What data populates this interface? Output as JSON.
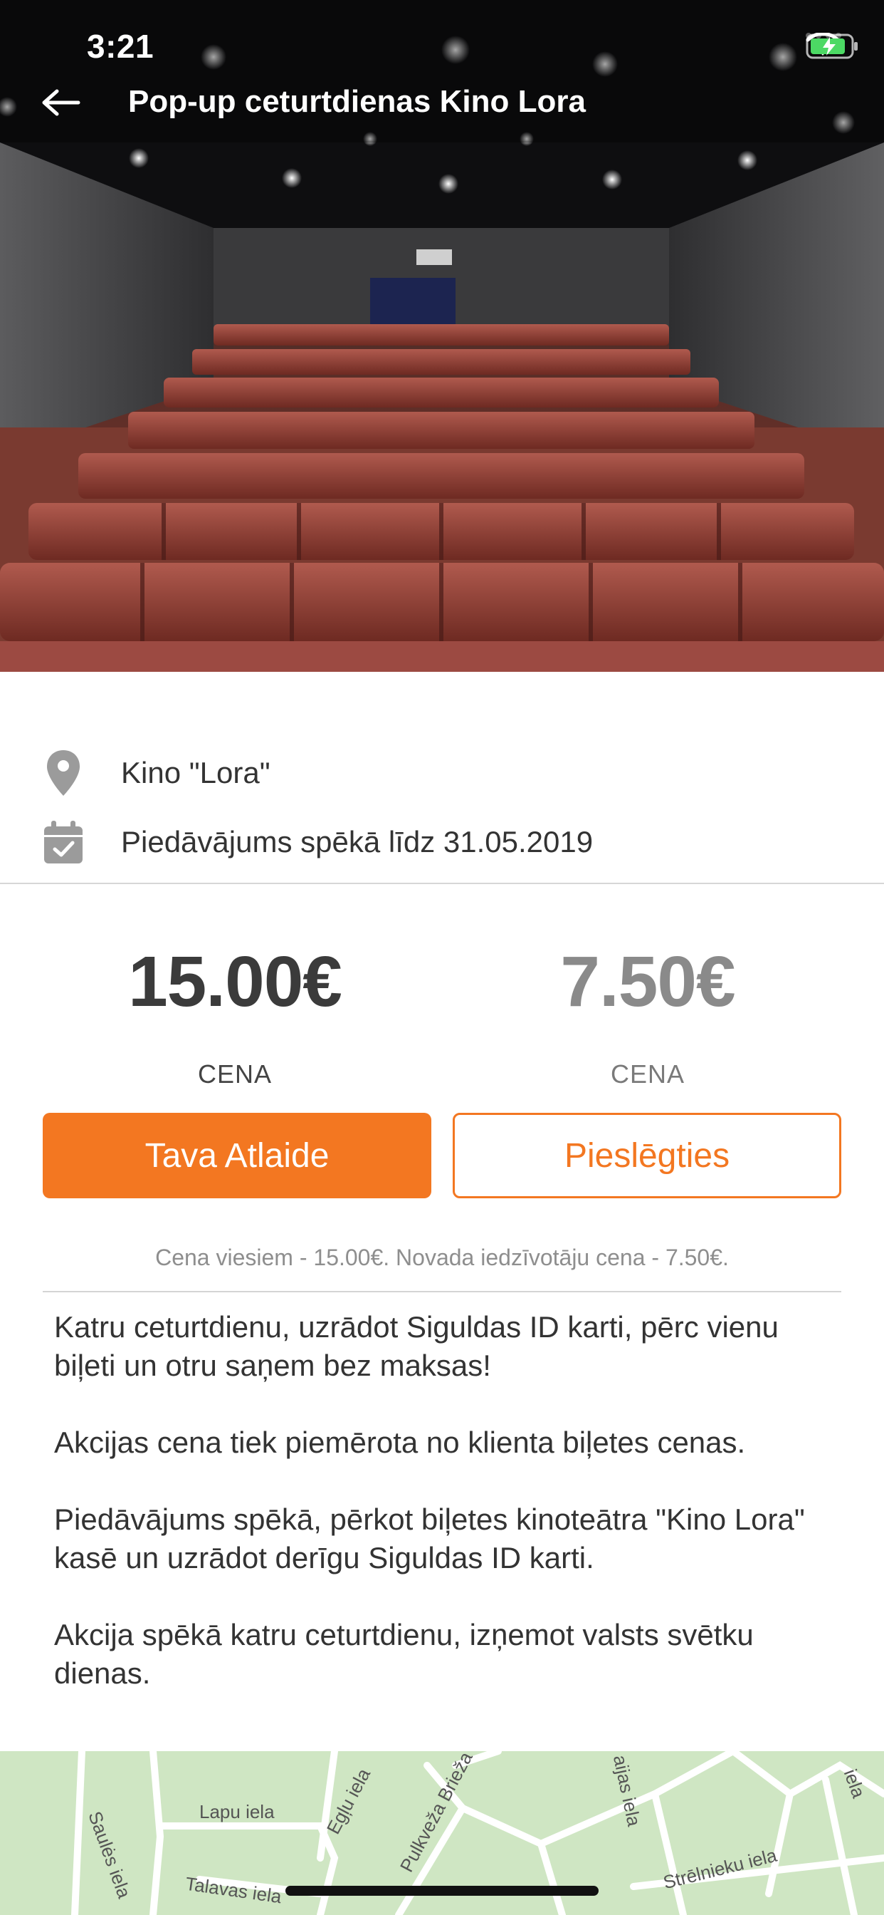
{
  "status_bar": {
    "time": "3:21"
  },
  "nav": {
    "title": "Pop-up ceturtdienas Kino Lora",
    "back_icon": "arrow-left-icon"
  },
  "info": {
    "location": {
      "icon": "map-pin-icon",
      "text": "Kino \"Lora\""
    },
    "validity": {
      "icon": "calendar-check-icon",
      "text": "Piedāvājums spēkā līdz 31.05.2019"
    }
  },
  "pricing": {
    "full_price": "15.00€",
    "full_label": "CENA",
    "discount_price": "7.50€",
    "discount_label": "CENA",
    "primary_button": "Tava Atlaide",
    "secondary_button": "Pieslēgties",
    "note": "Cena viesiem - 15.00€. Novada iedzīvotāju cena - 7.50€."
  },
  "description": [
    "Katru ceturtdienu, uzrādot Siguldas ID karti, pērc vienu biļeti un otru saņem bez maksas!",
    "Akcijas cena tiek piemērota no klienta biļetes cenas.",
    "Piedāvājums spēkā, pērkot biļetes kinoteātra \"Kino Lora\" kasē un uzrādot derīgu Siguldas ID karti.",
    "Akcija spēkā katru ceturtdienu, izņemot valsts svētku dienas."
  ],
  "map": {
    "streets": [
      "Lapu iela",
      "Egļu iela",
      "Pulkveža Brieža",
      "Saulės iela",
      "Talavas iela",
      "Strēlnieku iela",
      "aijas iela",
      "iela"
    ]
  },
  "colors": {
    "accent": "#f37721",
    "map_bg": "#cfe6c3"
  }
}
